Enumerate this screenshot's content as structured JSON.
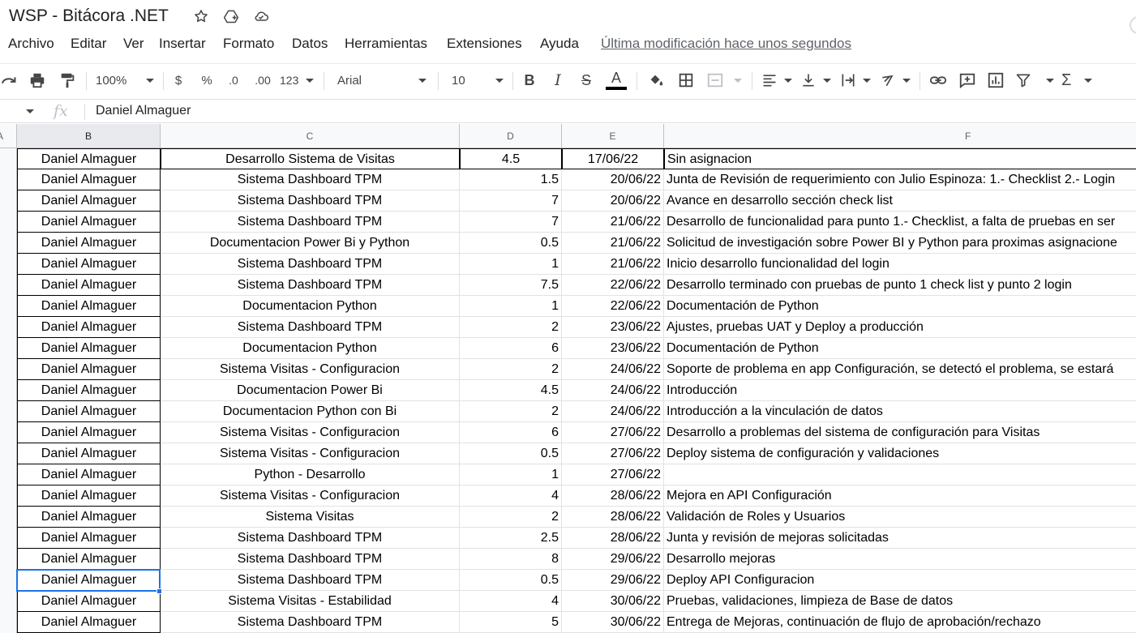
{
  "title": "WSP - Bitácora .NET",
  "title_icons": [
    "star-icon",
    "move-to-drive-icon",
    "cloud-saved-icon"
  ],
  "menu": [
    "Archivo",
    "Editar",
    "Ver",
    "Insertar",
    "Formato",
    "Datos",
    "Herramientas",
    "Extensiones",
    "Ayuda"
  ],
  "last_edit": "Última modificación hace unos segundos",
  "toolbar": {
    "zoom": "100%",
    "currency": "$",
    "percent": "%",
    "dec_decrease": ".0",
    "dec_increase": ".00",
    "more_formats": "123",
    "font": "Arial",
    "font_size": "10",
    "bold": "B",
    "italic": "I",
    "strike": "S",
    "text_color": "A",
    "sum": "Σ"
  },
  "formula_bar": {
    "fx": "fx",
    "content": "Daniel Almaguer"
  },
  "columns": [
    "A",
    "B",
    "C",
    "D",
    "E",
    "F"
  ],
  "rows": [
    {
      "b": "Daniel Almaguer",
      "c": "Desarrollo Sistema de Visitas",
      "d": "4.5",
      "e": "17/06/22",
      "f": "Sin asignacion"
    },
    {
      "b": "Daniel Almaguer",
      "c": "Sistema Dashboard TPM",
      "d": "1.5",
      "e": "20/06/22",
      "f": "Junta de Revisión de requerimiento con Julio Espinoza: 1.- Checklist 2.- Login"
    },
    {
      "b": "Daniel Almaguer",
      "c": "Sistema Dashboard TPM",
      "d": "7",
      "e": "20/06/22",
      "f": "Avance en desarrollo sección check list"
    },
    {
      "b": "Daniel Almaguer",
      "c": "Sistema Dashboard TPM",
      "d": "7",
      "e": "21/06/22",
      "f": "Desarrollo de funcionalidad para punto 1.- Checklist, a falta de pruebas en ser"
    },
    {
      "b": "Daniel Almaguer",
      "c": "Documentacion Power Bi y Python",
      "d": "0.5",
      "e": "21/06/22",
      "f": "Solicitud de investigación sobre Power BI y Python para proximas asignacione"
    },
    {
      "b": "Daniel Almaguer",
      "c": "Sistema Dashboard TPM",
      "d": "1",
      "e": "21/06/22",
      "f": "Inicio desarrollo funcionalidad del login"
    },
    {
      "b": "Daniel Almaguer",
      "c": "Sistema Dashboard TPM",
      "d": "7.5",
      "e": "22/06/22",
      "f": "Desarrollo terminado con pruebas de punto 1 check list y punto 2 login"
    },
    {
      "b": "Daniel Almaguer",
      "c": "Documentacion Python",
      "d": "1",
      "e": "22/06/22",
      "f": "Documentación de Python"
    },
    {
      "b": "Daniel Almaguer",
      "c": "Sistema Dashboard TPM",
      "d": "2",
      "e": "23/06/22",
      "f": "Ajustes, pruebas UAT y Deploy a producción"
    },
    {
      "b": "Daniel Almaguer",
      "c": "Documentacion Python",
      "d": "6",
      "e": "23/06/22",
      "f": "Documentación de Python"
    },
    {
      "b": "Daniel Almaguer",
      "c": "Sistema Visitas - Configuracion",
      "d": "2",
      "e": "24/06/22",
      "f": "Soporte de problema en app Configuración, se detectó el problema, se estará"
    },
    {
      "b": "Daniel Almaguer",
      "c": "Documentacion Power Bi",
      "d": "4.5",
      "e": "24/06/22",
      "f": "Introducción"
    },
    {
      "b": "Daniel Almaguer",
      "c": "Documentacion Python con Bi",
      "d": "2",
      "e": "24/06/22",
      "f": "Introducción a la vinculación de datos"
    },
    {
      "b": "Daniel Almaguer",
      "c": "Sistema Visitas - Configuracion",
      "d": "6",
      "e": "27/06/22",
      "f": "Desarrollo a problemas del sistema de configuración para Visitas"
    },
    {
      "b": "Daniel Almaguer",
      "c": "Sistema Visitas - Configuracion",
      "d": "0.5",
      "e": "27/06/22",
      "f": "Deploy sistema de configuración y validaciones"
    },
    {
      "b": "Daniel Almaguer",
      "c": "Python - Desarrollo",
      "d": "1",
      "e": "27/06/22",
      "f": ""
    },
    {
      "b": "Daniel Almaguer",
      "c": "Sistema Visitas - Configuracion",
      "d": "4",
      "e": "28/06/22",
      "f": "Mejora en API Configuración"
    },
    {
      "b": "Daniel Almaguer",
      "c": "Sistema Visitas",
      "d": "2",
      "e": "28/06/22",
      "f": "Validación de Roles y Usuarios"
    },
    {
      "b": "Daniel Almaguer",
      "c": "Sistema Dashboard TPM",
      "d": "2.5",
      "e": "28/06/22",
      "f": "Junta y revisión de mejoras solicitadas"
    },
    {
      "b": "Daniel Almaguer",
      "c": "Sistema Dashboard TPM",
      "d": "8",
      "e": "29/06/22",
      "f": "Desarrollo mejoras"
    },
    {
      "b": "Daniel Almaguer",
      "c": "Sistema Dashboard TPM",
      "d": "0.5",
      "e": "29/06/22",
      "f": "Deploy API Configuracion"
    },
    {
      "b": "Daniel Almaguer",
      "c": "Sistema Visitas - Estabilidad",
      "d": "4",
      "e": "30/06/22",
      "f": "Pruebas, validaciones, limpieza de Base de datos"
    },
    {
      "b": "Daniel Almaguer",
      "c": "Sistema Dashboard TPM",
      "d": "5",
      "e": "30/06/22",
      "f": "Entrega de Mejoras, continuación de flujo de aprobación/rechazo"
    }
  ],
  "selected_row_index": 20,
  "colors": {
    "selection": "#1a73e8",
    "header_bg": "#f8f9fa",
    "grid_line": "#e2e2e2"
  }
}
